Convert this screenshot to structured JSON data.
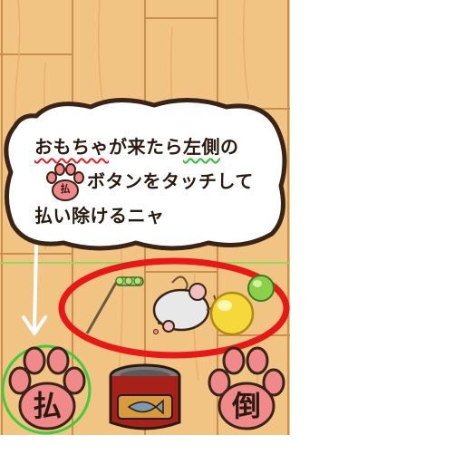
{
  "tutorial": {
    "line1_part1": "おもちゃ",
    "line1_part2": "が来たら",
    "line1_part3": "左側",
    "line1_part4": "の",
    "line2_icon_label": "払",
    "line2_text": "ボタンをタッチして",
    "line3_text": "払い除けるニャ"
  },
  "buttons": {
    "left_paw_label": "払",
    "right_paw_label": "倒"
  },
  "colors": {
    "floor": "#f2c483",
    "paw_pink": "#f08a8a",
    "highlight_green": "#3ccc3c",
    "highlight_red": "#e81818",
    "can_red": "#a8201a"
  }
}
